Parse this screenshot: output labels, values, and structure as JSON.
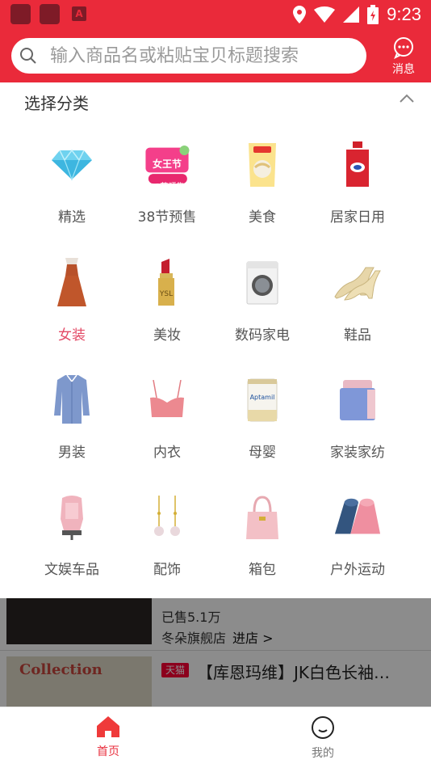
{
  "status_bar": {
    "time": "9:23",
    "app_badge_letter": "A"
  },
  "header": {
    "search_placeholder": "输入商品名或粘贴宝贝标题搜索",
    "message_label": "消息",
    "accent_color": "#ea2a3a"
  },
  "panel": {
    "title": "选择分类",
    "categories": [
      {
        "label": "精选",
        "icon": "diamond-icon"
      },
      {
        "label": "38节预售",
        "icon": "presale-banner-icon",
        "badge_top": "女王节",
        "badge_bottom": "38节预售"
      },
      {
        "label": "美食",
        "icon": "snack-bag-icon"
      },
      {
        "label": "居家日用",
        "icon": "detergent-bottle-icon"
      },
      {
        "label": "女装",
        "icon": "dress-icon",
        "selected": true
      },
      {
        "label": "美妆",
        "icon": "lipstick-icon"
      },
      {
        "label": "数码家电",
        "icon": "washing-machine-icon"
      },
      {
        "label": "鞋品",
        "icon": "heels-icon"
      },
      {
        "label": "男装",
        "icon": "shirt-icon"
      },
      {
        "label": "内衣",
        "icon": "bra-icon"
      },
      {
        "label": "母婴",
        "icon": "formula-can-icon",
        "can_text": "Aptamil"
      },
      {
        "label": "家装家纺",
        "icon": "bedding-icon"
      },
      {
        "label": "文娱车品",
        "icon": "car-seat-icon"
      },
      {
        "label": "配饰",
        "icon": "earrings-icon"
      },
      {
        "label": "箱包",
        "icon": "handbag-icon"
      },
      {
        "label": "户外运动",
        "icon": "yoga-mat-icon"
      }
    ]
  },
  "list": {
    "item1": {
      "sold": "已售5.1万",
      "shop": "冬朵旗舰店",
      "enter": "进店 >"
    },
    "item2": {
      "badge": "天猫",
      "title": "【库恩玛维】JK白色长袖…",
      "image_text": "Collection"
    }
  },
  "nav": {
    "home": "首页",
    "me": "我的"
  }
}
